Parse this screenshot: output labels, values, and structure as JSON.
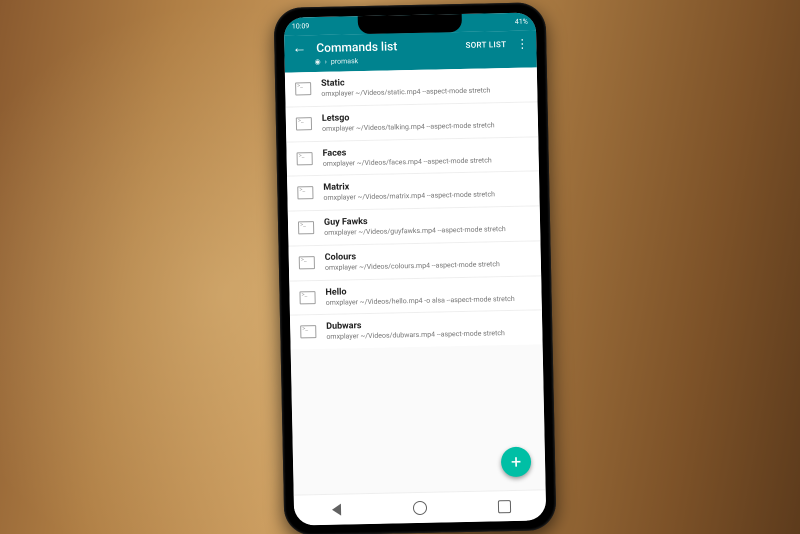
{
  "status": {
    "time": "10:09",
    "battery": "41%"
  },
  "appbar": {
    "title": "Commands list",
    "sort_label": "SORT LIST",
    "breadcrumb_device": "promask"
  },
  "commands": [
    {
      "title": "Static",
      "sub": "omxplayer ~/Videos/static.mp4 --aspect-mode stretch"
    },
    {
      "title": "Letsgo",
      "sub": "omxplayer ~/Videos/talking.mp4 --aspect-mode stretch"
    },
    {
      "title": "Faces",
      "sub": "omxplayer ~/Videos/faces.mp4 --aspect-mode stretch"
    },
    {
      "title": "Matrix",
      "sub": "omxplayer ~/Videos/matrix.mp4 --aspect-mode stretch"
    },
    {
      "title": "Guy Fawks",
      "sub": "omxplayer ~/Videos/guyfawks.mp4 --aspect-mode stretch"
    },
    {
      "title": "Colours",
      "sub": "omxplayer ~/Videos/colours.mp4 --aspect-mode stretch"
    },
    {
      "title": "Hello",
      "sub": "omxplayer ~/Videos/hello.mp4 -o alsa --aspect-mode stretch"
    },
    {
      "title": "Dubwars",
      "sub": "omxplayer ~/Videos/dubwars.mp4 --aspect-mode stretch"
    }
  ],
  "fab": {
    "label": "+"
  }
}
